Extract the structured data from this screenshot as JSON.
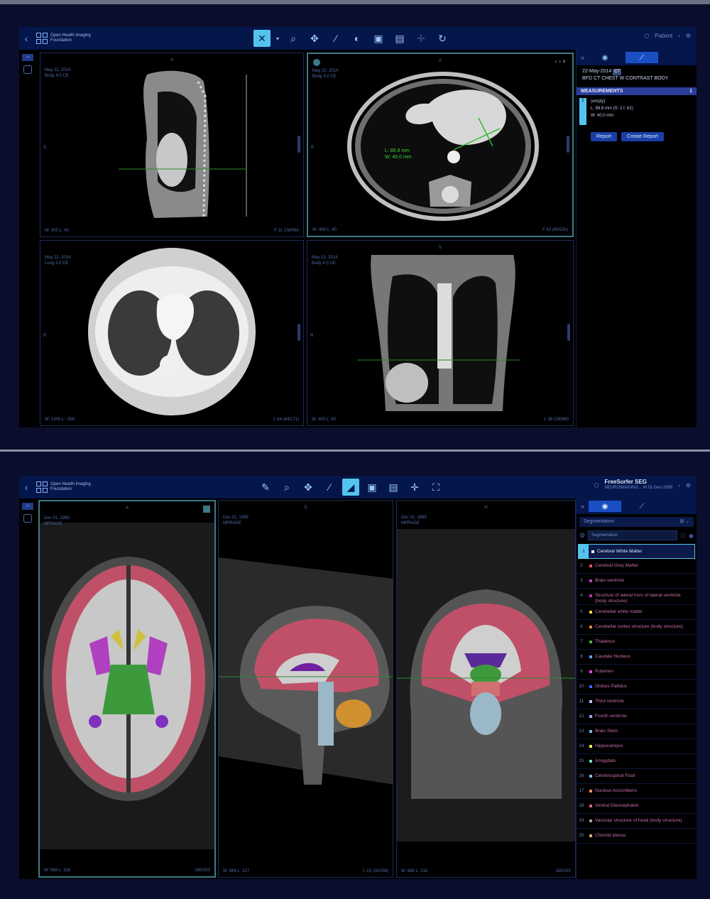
{
  "app": {
    "logo_text": "Open Health Imaging Foundation"
  },
  "top": {
    "toolbar": {
      "patient_label": "Patient"
    },
    "viewports": [
      {
        "id": "sag",
        "orientation": "A",
        "date": "May 22, 2014",
        "series": "Body 4.0 CE",
        "side": "S",
        "wl": "W: 400 L: 40",
        "instance": "F 31 CM/960"
      },
      {
        "id": "axial",
        "orientation": "A",
        "date": "May 22, 2014",
        "series": "Body 3.0 CE",
        "side": "R",
        "wl": "W: 400 L: 40",
        "instance": "F 42 (80/530)",
        "annotation_l": "L: 88.8 mm",
        "annotation_w": "W: 40.0 mm"
      },
      {
        "id": "lung",
        "orientation": "A",
        "date": "May 22, 2014",
        "series": "Lung 3.0 CE",
        "side": "R",
        "wl": "W: 1400 L: -500",
        "instance": "I: 64 (64/171)"
      },
      {
        "id": "coronal",
        "orientation": "S",
        "date": "May 22, 2014",
        "series": "Body 4.0 CE",
        "side": "R",
        "wl": "W: 400 L: 40",
        "instance": "I: 38 CM/960"
      }
    ],
    "panel": {
      "study_date": "22-May-2014",
      "study_badge": "CT",
      "study_desc": "BFD CT CHEST W CONTRAST BODY",
      "measurements_label": "MEASUREMENTS",
      "measurements_count": "1",
      "item_num": "1",
      "item_name": "(empty)",
      "item_l": "L: 88.8 mm (S: 2 I: 62)",
      "item_w": "W: 40.0 mm",
      "report_button": "Report",
      "create_report_button": "Create Report"
    }
  },
  "bottom": {
    "toolbar": {
      "seg_title": "FreeSurfer SEG",
      "seg_sub": "NEUROIMAGING... M 01-Dec-1999"
    },
    "viewports": [
      {
        "id": "ax",
        "orientation": "A",
        "date": "Dec 01, 1999",
        "series": "MPRAGE",
        "wl": "W: 688 L: 316",
        "instance": "160/320"
      },
      {
        "id": "sag",
        "orientation": "S",
        "date": "Dec 01, 1999",
        "series": "MPRAGE",
        "wl": "W: 688 L: 317",
        "instance": "I: 15 (16/256)"
      },
      {
        "id": "cor",
        "orientation": "H",
        "date": "Dec 01, 1999",
        "series": "MPRAGE",
        "wl": "W: 688 L: 316",
        "instance": "160/320"
      }
    ],
    "panel": {
      "seg_header": "Segmentation",
      "seg_dropdown": "Segmentation",
      "segments": [
        {
          "n": "1",
          "label": "Cerebral White Matter",
          "color": "#f5f5f5"
        },
        {
          "n": "2",
          "label": "Cerebral Grey Matter",
          "color": "#e05560"
        },
        {
          "n": "3",
          "label": "Brain ventricle",
          "color": "#c040c0"
        },
        {
          "n": "4",
          "label": "Structure of lateral horn of lateral ventricle (body structure)",
          "color": "#b030b0"
        },
        {
          "n": "5",
          "label": "Cerebellar white matter",
          "color": "#f0d040"
        },
        {
          "n": "6",
          "label": "Cerebellar cortex structure (body structure)",
          "color": "#e08a30"
        },
        {
          "n": "7",
          "label": "Thalamus",
          "color": "#40b040"
        },
        {
          "n": "8",
          "label": "Caudate Nucleus",
          "color": "#60a0ff"
        },
        {
          "n": "9",
          "label": "Putamen",
          "color": "#e040e0"
        },
        {
          "n": "10",
          "label": "Globus Pallidus",
          "color": "#4060ff"
        },
        {
          "n": "11",
          "label": "Third ventricle",
          "color": "#c0c0ff"
        },
        {
          "n": "12",
          "label": "Fourth ventricle",
          "color": "#a0a0f0"
        },
        {
          "n": "13",
          "label": "Brain Stem",
          "color": "#60c0e0"
        },
        {
          "n": "14",
          "label": "Hippocampus",
          "color": "#f0f060"
        },
        {
          "n": "15",
          "label": "Amygdala",
          "color": "#60e0c0"
        },
        {
          "n": "16",
          "label": "Cerebrospinal Fluid",
          "color": "#80c0ff"
        },
        {
          "n": "17",
          "label": "Nucleus Accumbens",
          "color": "#ff9060"
        },
        {
          "n": "18",
          "label": "Ventral Diencephalon",
          "color": "#e06080"
        },
        {
          "n": "19",
          "label": "Vascular structure of head (body structure)",
          "color": "#a0a0a0"
        },
        {
          "n": "20",
          "label": "Choroid plexus",
          "color": "#d0b070"
        }
      ]
    }
  }
}
